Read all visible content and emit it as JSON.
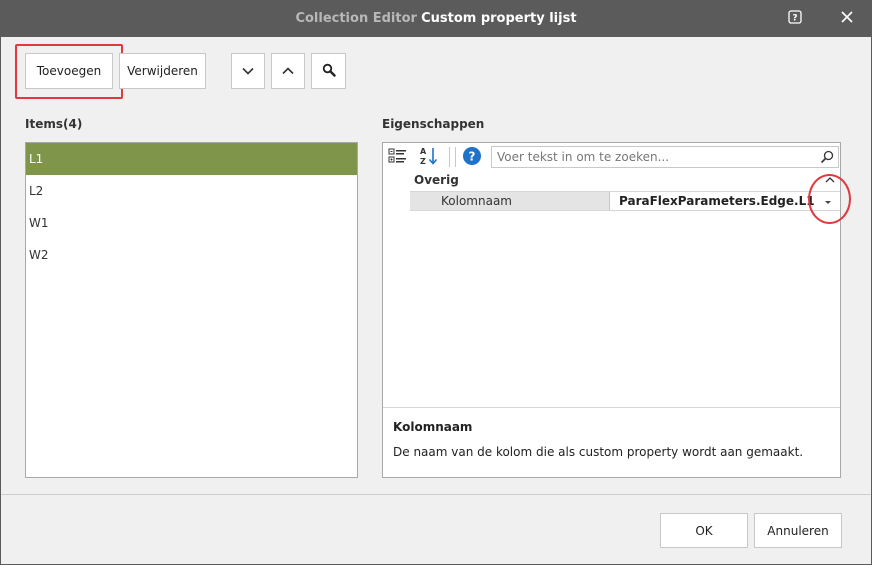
{
  "window": {
    "title_prefix": "Collection Editor",
    "title": "Custom property lijst",
    "help_icon": "help-icon",
    "close_icon": "close-icon"
  },
  "toolbar": {
    "add_label": "Toevoegen",
    "remove_label": "Verwijderen",
    "move_down_icon": "chevron-down-icon",
    "move_up_icon": "chevron-up-icon",
    "search_icon": "magnifier-icon"
  },
  "items_panel": {
    "label": "Items(4)",
    "items": [
      {
        "label": "L1",
        "selected": true
      },
      {
        "label": "L2",
        "selected": false
      },
      {
        "label": "W1",
        "selected": false
      },
      {
        "label": "W2",
        "selected": false
      }
    ]
  },
  "properties_panel": {
    "label": "Eigenschappen",
    "search_placeholder": "Voer tekst in om te zoeken...",
    "category": "Overig",
    "rows": [
      {
        "name": "Kolomnaam",
        "value": "ParaFlexParameters.Edge.L1"
      }
    ],
    "description_title": "Kolomnaam",
    "description_text": "De naam van de kolom die als custom property wordt aan gemaakt."
  },
  "footer": {
    "ok_label": "OK",
    "cancel_label": "Annuleren"
  },
  "colors": {
    "titlebar": "#5b5b5b",
    "selection": "#7f964a",
    "highlight": "#e0393e",
    "help_blue": "#1e73c8"
  }
}
